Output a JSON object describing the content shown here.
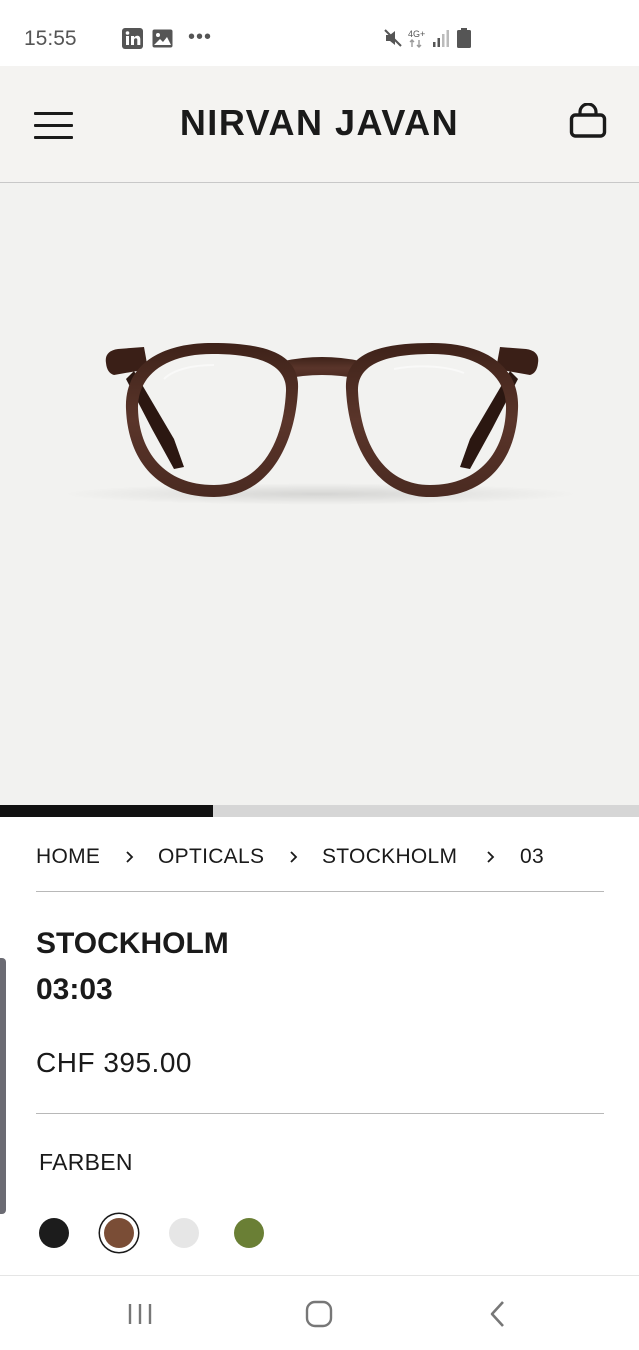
{
  "status_bar": {
    "time": "15:55",
    "icons": [
      "linkedin-icon",
      "gallery-icon",
      "more-icon",
      "mute-icon",
      "network-4g-icon",
      "signal-icon",
      "battery-icon"
    ],
    "more_glyph": "•••",
    "network_label": "4G+"
  },
  "header": {
    "brand": "NIRVAN JAVAN",
    "menu_icon": "hamburger-menu-icon",
    "cart_icon": "shopping-bag-icon"
  },
  "product_image": {
    "subject": "eyeglasses-brown-frame",
    "frame_color": "#4f2f26"
  },
  "carousel": {
    "progress": 0.333
  },
  "breadcrumb": {
    "items": [
      {
        "label": "HOME"
      },
      {
        "label": "OPTICALS"
      },
      {
        "label": "STOCKHOLM"
      },
      {
        "label": "03"
      }
    ],
    "separator_icon": "chevron-right-icon"
  },
  "product": {
    "name_line1": "STOCKHOLM",
    "name_line2": "03:03",
    "price": "CHF 395.00",
    "colors_label": "FARBEN",
    "colors": [
      {
        "hex": "#1c1c1c",
        "selected": false
      },
      {
        "hex": "#7a4d36",
        "selected": true
      },
      {
        "hex": "#e6e6e6",
        "selected": false
      },
      {
        "hex": "#6a7f35",
        "selected": false
      }
    ]
  },
  "nav_bar": {
    "icons": [
      "recent-apps-icon",
      "home-icon",
      "back-icon"
    ]
  }
}
